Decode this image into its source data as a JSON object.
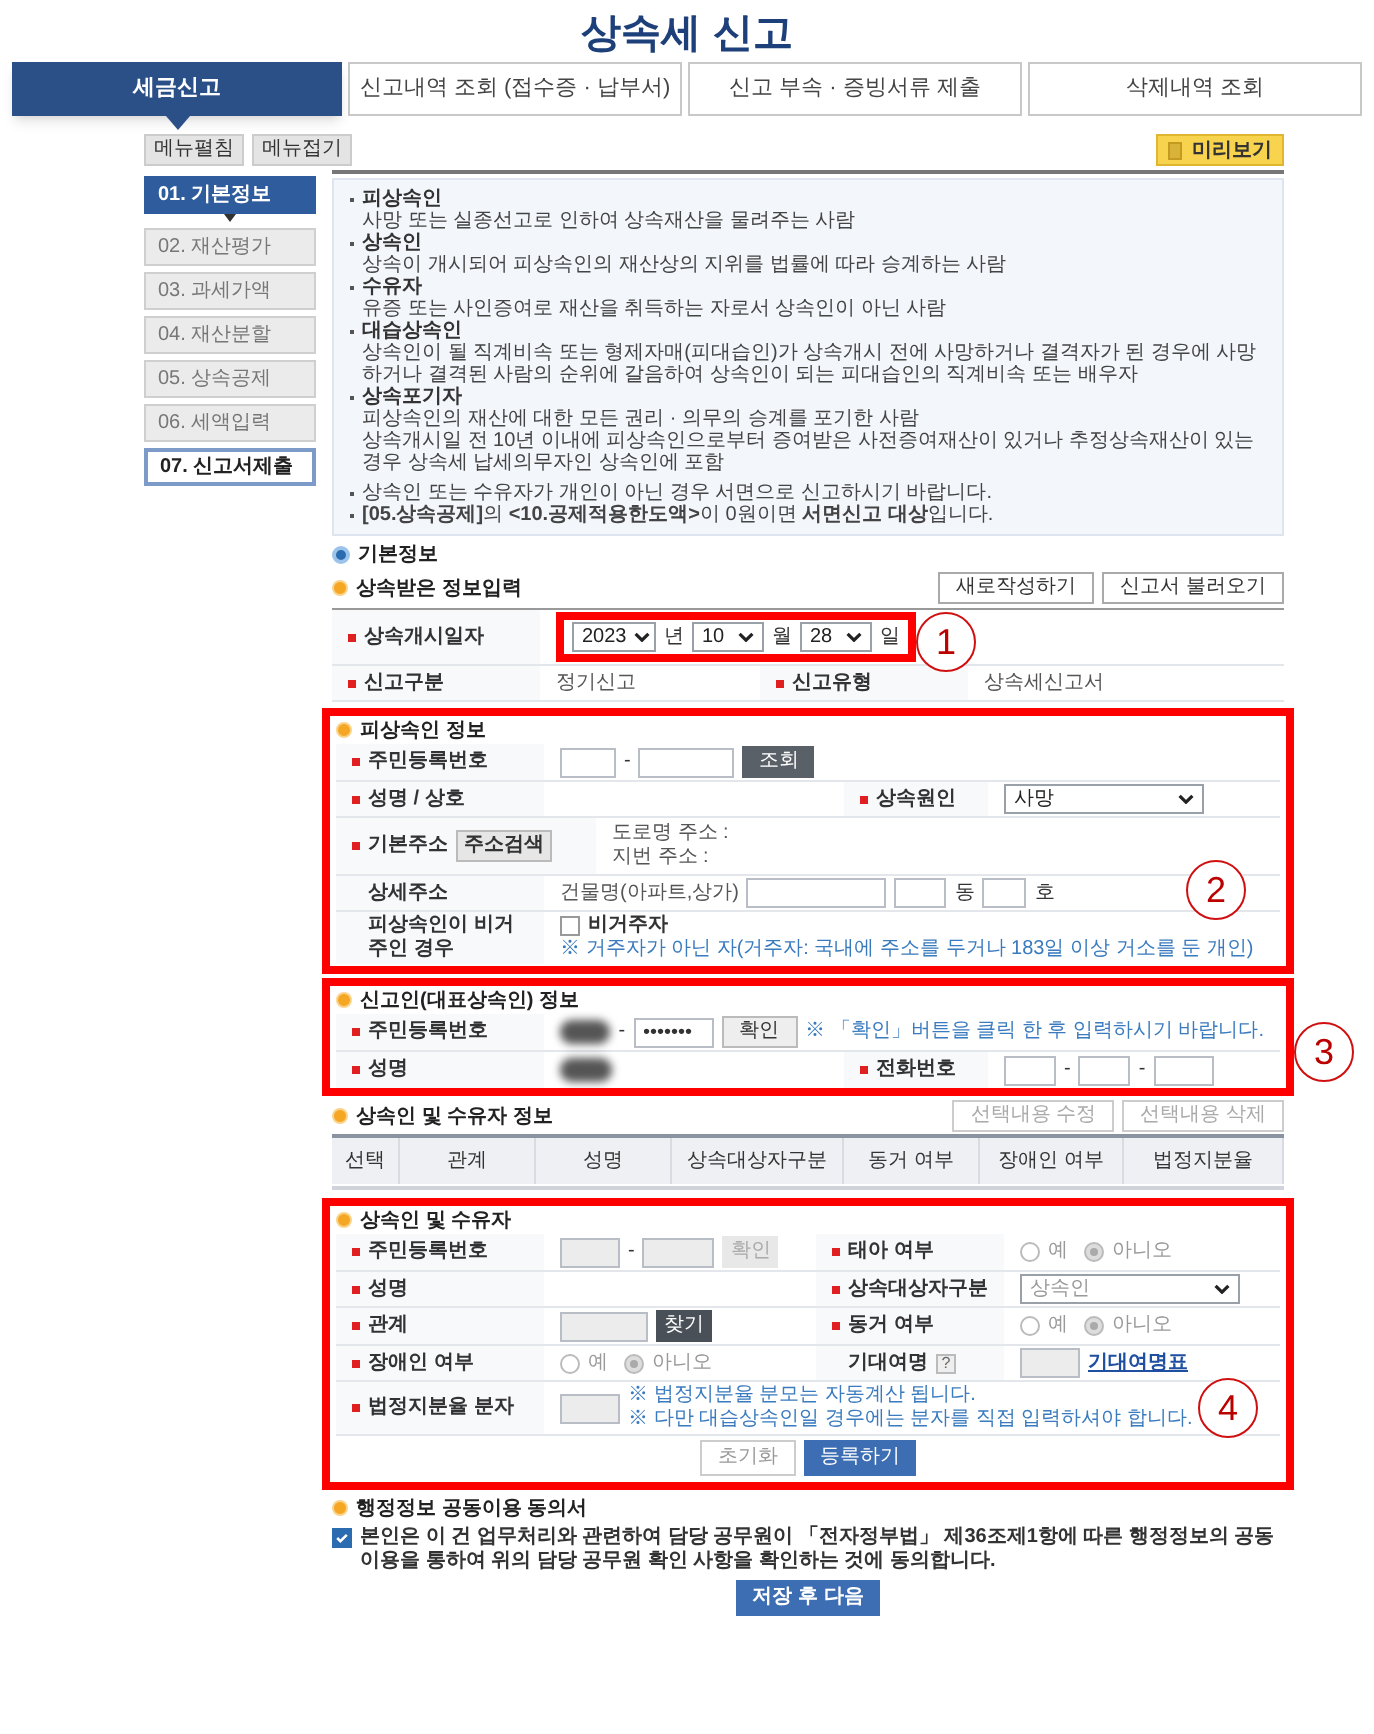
{
  "title": "상속세 신고",
  "tabs": [
    {
      "label": "세금신고",
      "selected": true
    },
    {
      "label": "신고내역 조회 (접수증 · 납부서)",
      "selected": false
    },
    {
      "label": "신고 부속 · 증빙서류 제출",
      "selected": false
    },
    {
      "label": "삭제내역 조회",
      "selected": false
    }
  ],
  "sidebar": {
    "buttons": [
      "메뉴펼침",
      "메뉴접기"
    ],
    "steps": [
      {
        "label": "01. 기본정보",
        "selected": true,
        "disabled": false
      },
      {
        "label": "02. 재산평가",
        "selected": false,
        "disabled": true
      },
      {
        "label": "03. 과세가액",
        "selected": false,
        "disabled": true
      },
      {
        "label": "04. 재산분할",
        "selected": false,
        "disabled": true
      },
      {
        "label": "05. 상속공제",
        "selected": false,
        "disabled": true
      },
      {
        "label": "06. 세액입력",
        "selected": false,
        "disabled": true
      },
      {
        "label": "07. 신고서제출",
        "selected": false,
        "disabled": false
      }
    ]
  },
  "preview_button": "미리보기",
  "info": {
    "terms": [
      {
        "term": "피상속인",
        "lines": [
          "사망 또는 실종선고로 인하여 상속재산을 물려주는 사람"
        ]
      },
      {
        "term": "상속인",
        "lines": [
          "상속이 개시되어 피상속인의 재산상의 지위를 법률에 따라 승계하는 사람"
        ]
      },
      {
        "term": "수유자",
        "lines": [
          "유증 또는 사인증여로 재산을 취득하는 자로서 상속인이 아닌 사람"
        ]
      },
      {
        "term": "대습상속인",
        "lines": [
          "상속인이 될 직계비속 또는 형제자매(피대습인)가 상속개시 전에 사망하거나 결격자가 된 경우에 사망하거나 결격된 사람의 순위에 갈음하여 상속인이 되는 피대습인의 직계비속 또는 배우자"
        ]
      },
      {
        "term": "상속포기자",
        "lines": [
          "피상속인의 재산에 대한 모든 권리 · 의무의 승계를 포기한 사람",
          "상속개시일 전 10년 이내에 피상속인으로부터 증여받은 사전증여재산이 있거나 추정상속재산이 있는 경우 상속세 납세의무자인 상속인에 포함"
        ]
      }
    ],
    "notes": [
      "상속인 또는 수유자가 개인이 아닌 경우 서면으로 신고하시기 바랍니다.",
      "**[05.상속공제]**의 **<10.공제적용한도액>**이 0원이면 **서면신고 대상**입니다."
    ]
  },
  "basic_info": {
    "heading": "기본정보",
    "subheading": "상속받은 정보입력",
    "buttons": [
      "새로작성하기",
      "신고서 불러오기"
    ],
    "callout": "1",
    "start_date": {
      "label": {
        "text": "상속개시일자",
        "required": true
      },
      "year": "2023",
      "year_unit": "년",
      "month": "10",
      "month_unit": "월",
      "day": "28",
      "day_unit": "일"
    },
    "report_kind": {
      "label": {
        "text": "신고구분",
        "required": true
      },
      "value": "정기신고"
    },
    "form_type": {
      "label": {
        "text": "신고유형",
        "required": true
      },
      "value": "상속세신고서"
    }
  },
  "decedent": {
    "callout": "2",
    "heading": "피상속인 정보",
    "id": {
      "label": {
        "text": "주민등록번호",
        "required": true
      },
      "dash": "-",
      "button": "조회"
    },
    "name": {
      "label": {
        "text": "성명 / 상호",
        "required": true
      }
    },
    "cause": {
      "label": {
        "text": "상속원인",
        "required": true
      },
      "value": "사망"
    },
    "address": {
      "label": {
        "text": "기본주소",
        "required": true
      },
      "button": "주소검색",
      "road": "도로명 주소 :",
      "lot": "지번 주소 :"
    },
    "detail": {
      "label": {
        "text": "상세주소",
        "required": false
      },
      "building": "건물명(아파트,상가)",
      "dong": "동",
      "ho": "호"
    },
    "nonresident": {
      "label": {
        "text": "피상속인이 비거주인 경우",
        "required": false
      },
      "checkbox": "비거주자",
      "checked": false,
      "note": "※ 거주자가 아닌 자(거주자: 국내에 주소를 두거나 183일 이상 거소를 둔 개인)"
    }
  },
  "reporter": {
    "callout": "3",
    "heading": "신고인(대표상속인) 정보",
    "id": {
      "label": {
        "text": "주민등록번호",
        "required": true
      },
      "dash": "-",
      "masked": "•••••••",
      "button": "확인",
      "note": "※ 「확인」버튼을 클릭 한 후 입력하시기 바랍니다."
    },
    "name": {
      "label": {
        "text": "성명",
        "required": true
      }
    },
    "phone": {
      "label": {
        "text": "전화번호",
        "required": true
      },
      "dashes": [
        "-",
        "-"
      ]
    }
  },
  "heirs": {
    "heading": "상속인 및 수유자 정보",
    "buttons": [
      "선택내용 수정",
      "선택내용 삭제"
    ],
    "columns": [
      "선택",
      "관계",
      "성명",
      "상속대상자구분",
      "동거 여부",
      "장애인 여부",
      "법정지분율"
    ]
  },
  "heir_form": {
    "callout": "4",
    "heading": "상속인 및 수유자",
    "id": {
      "label": {
        "text": "주민등록번호",
        "required": true
      },
      "dash": "-",
      "button": "확인"
    },
    "fetus": {
      "label": {
        "text": "태아 여부",
        "required": true
      },
      "options": [
        {
          "label": "예",
          "selected": false
        },
        {
          "label": "아니오",
          "selected": true
        }
      ]
    },
    "name": {
      "label": {
        "text": "성명",
        "required": true
      }
    },
    "category": {
      "label": {
        "text": "상속대상자구분",
        "required": true
      },
      "value": "상속인"
    },
    "relation": {
      "label": {
        "text": "관계",
        "required": true
      },
      "button": "찾기"
    },
    "cohabit": {
      "label": {
        "text": "동거 여부",
        "required": true
      },
      "options": [
        {
          "label": "예",
          "selected": false
        },
        {
          "label": "아니오",
          "selected": true
        }
      ]
    },
    "disabled_person": {
      "label": {
        "text": "장애인 여부",
        "required": true
      },
      "options": [
        {
          "label": "예",
          "selected": false
        },
        {
          "label": "아니오",
          "selected": true
        }
      ]
    },
    "life": {
      "label": {
        "text": "기대여명",
        "required": false
      },
      "help": "?",
      "link": "기대여명표"
    },
    "share": {
      "label": {
        "text": "법정지분율 분자",
        "required": true
      },
      "notes": [
        "※ 법정지분율 분모는 자동계산 됩니다.",
        "※ 다만 대습상속인일 경우에는 분자를 직접 입력하셔야 합니다."
      ]
    },
    "buttons": [
      "초기화",
      "등록하기"
    ]
  },
  "consent": {
    "heading": "행정정보 공동이용 동의서",
    "checked": true,
    "text": "본인은 이 건 업무처리와 관련하여 담당 공무원이 「전자정부법」 제36조제1항에 따른 행정정보의 공동이용을 통하여 위의 담당 공무원 확인 사항을 확인하는 것에 동의합니다."
  },
  "save_button": "저장 후 다음"
}
